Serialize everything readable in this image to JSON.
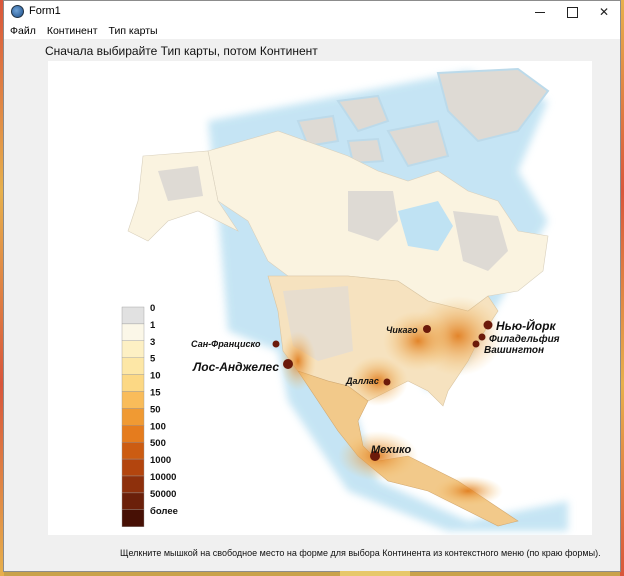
{
  "window": {
    "title": "Form1",
    "controls": {
      "minimize": "minimize-icon",
      "maximize": "maximize-icon",
      "close": "close-icon"
    }
  },
  "menu": {
    "items": [
      "Файл",
      "Континент",
      "Тип карты"
    ]
  },
  "instruction": "Сначала выбирайте Тип карты, потом Континент",
  "map": {
    "legend": {
      "labels": [
        "0",
        "1",
        "3",
        "5",
        "10",
        "15",
        "50",
        "100",
        "500",
        "1000",
        "10000",
        "50000",
        "более"
      ],
      "colors": [
        "#e1e1e1",
        "#fbf7e8",
        "#fdf0c4",
        "#fde7a6",
        "#fcd884",
        "#f9bc5a",
        "#f09a33",
        "#e57c1e",
        "#cc5c12",
        "#b3450e",
        "#8e300c",
        "#6b200a",
        "#471005"
      ]
    },
    "cities": {
      "sf": "Сан-Франциско",
      "la": "Лос-Анджелес",
      "chicago": "Чикаго",
      "ny": "Нью-Йорк",
      "philadelphia": "Филадельфия",
      "washington": "Вашингтон",
      "dallas": "Даллас",
      "mexico": "Мехико"
    }
  },
  "hint": "Щелкните мышкой на свободное место на форме для выбора Континента из контекстного меню (по краю формы)."
}
